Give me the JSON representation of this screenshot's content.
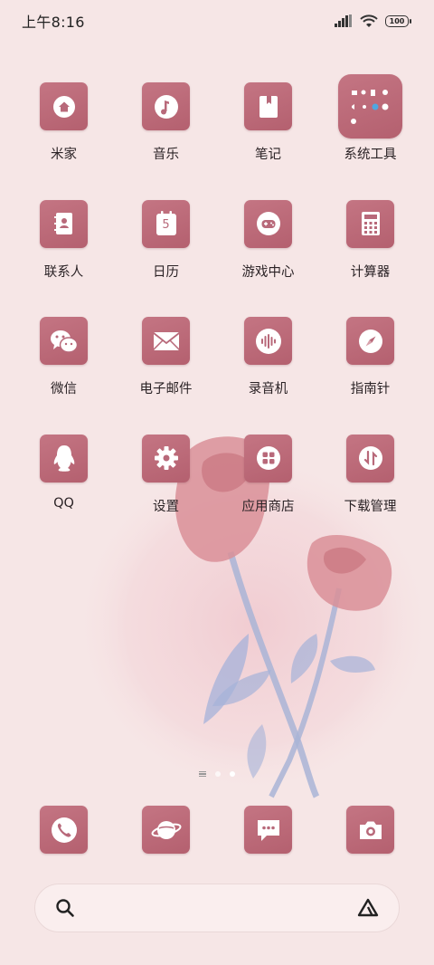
{
  "status_bar": {
    "time": "上午8:16",
    "battery": "100",
    "icons": [
      "signal-icon",
      "wifi-icon",
      "battery-icon"
    ]
  },
  "apps": [
    {
      "label": "米家",
      "icon": "home-icon"
    },
    {
      "label": "音乐",
      "icon": "music-note-icon"
    },
    {
      "label": "笔记",
      "icon": "notebook-icon"
    },
    {
      "label": "系统工具",
      "icon": "folder-icon"
    },
    {
      "label": "联系人",
      "icon": "contacts-icon"
    },
    {
      "label": "日历",
      "icon": "calendar-icon",
      "badge": "5"
    },
    {
      "label": "游戏中心",
      "icon": "gamepad-icon"
    },
    {
      "label": "计算器",
      "icon": "calculator-icon"
    },
    {
      "label": "微信",
      "icon": "wechat-icon"
    },
    {
      "label": "电子邮件",
      "icon": "mail-icon"
    },
    {
      "label": "录音机",
      "icon": "recorder-icon"
    },
    {
      "label": "指南针",
      "icon": "compass-icon"
    },
    {
      "label": "QQ",
      "icon": "penguin-icon"
    },
    {
      "label": "设置",
      "icon": "gear-icon"
    },
    {
      "label": "应用商店",
      "icon": "app-store-icon"
    },
    {
      "label": "下载管理",
      "icon": "download-icon"
    }
  ],
  "page_indicator": {
    "pages": 2,
    "active": 2
  },
  "dock": [
    {
      "icon": "phone-icon"
    },
    {
      "icon": "browser-planet-icon"
    },
    {
      "icon": "message-icon"
    },
    {
      "icon": "camera-icon"
    }
  ],
  "colors": {
    "background": "#f6e6e6",
    "tile": "#b8697a"
  }
}
